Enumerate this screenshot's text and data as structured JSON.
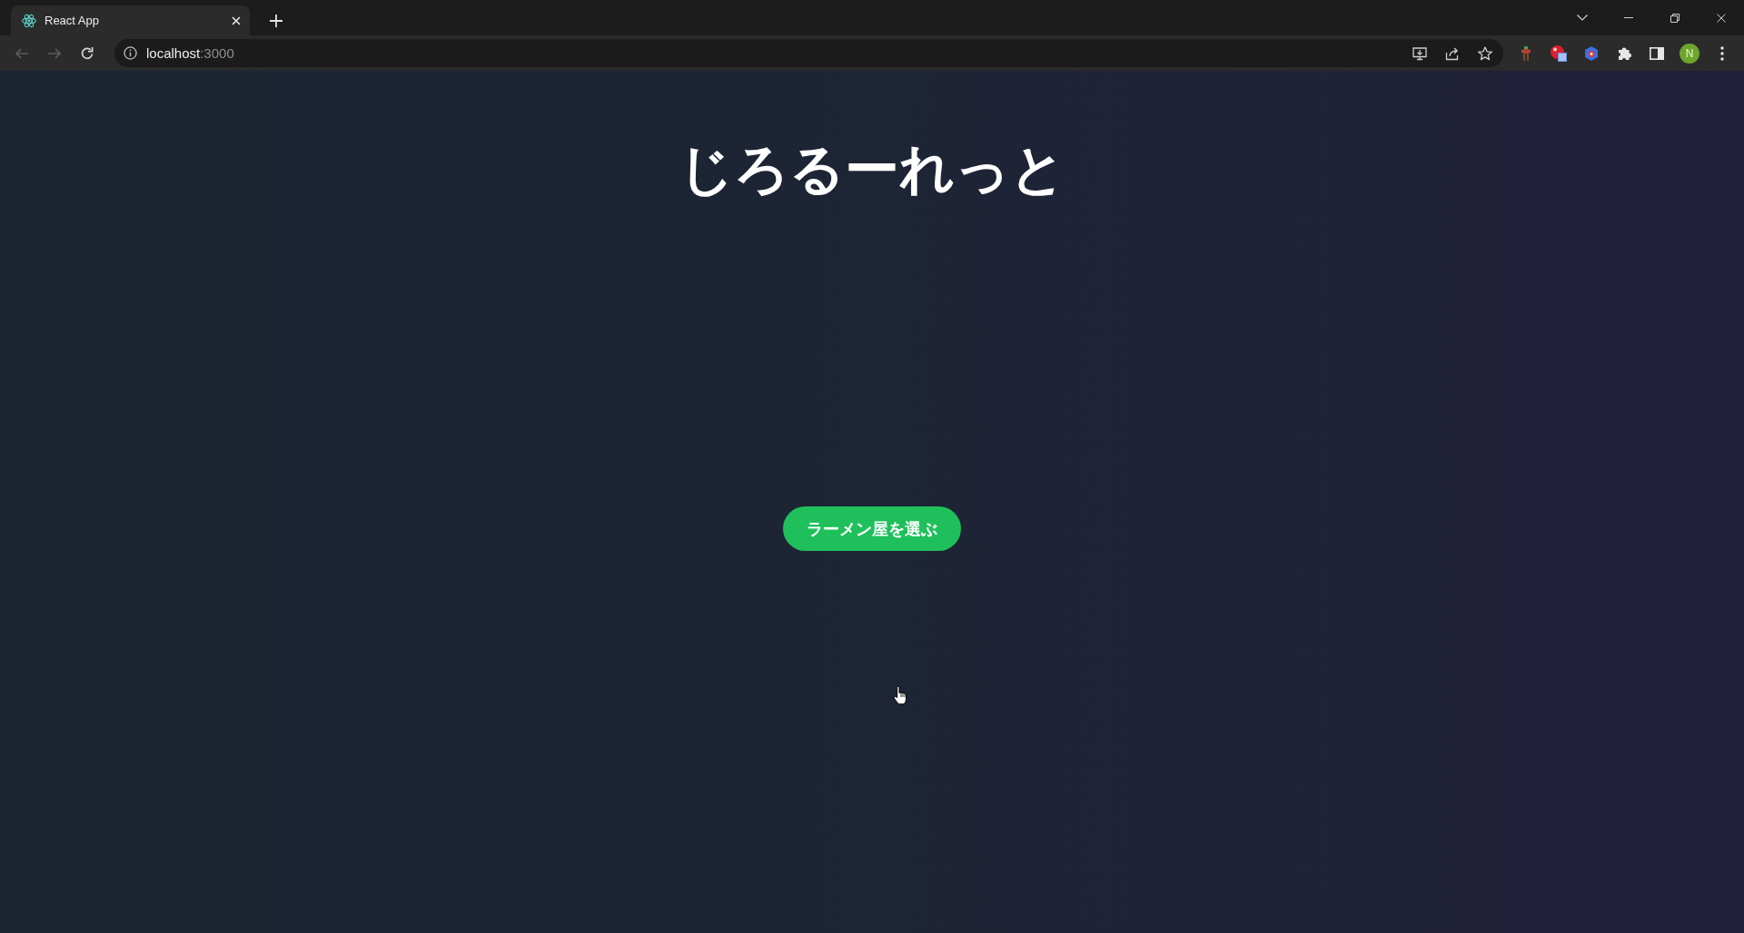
{
  "browser": {
    "tabs": [
      {
        "title": "React App",
        "selected": true
      }
    ],
    "nav_buttons": [
      {
        "kind": "back",
        "disabled": true
      },
      {
        "kind": "forward",
        "disabled": true
      },
      {
        "kind": "reload",
        "disabled": false
      }
    ],
    "address_bar": {
      "host": "localhost",
      "port": ":3000"
    },
    "profile": {
      "initial": "N"
    }
  },
  "page": {
    "title": "じろるーれっと",
    "button": {
      "label": "ラーメン屋を選ぶ"
    }
  }
}
